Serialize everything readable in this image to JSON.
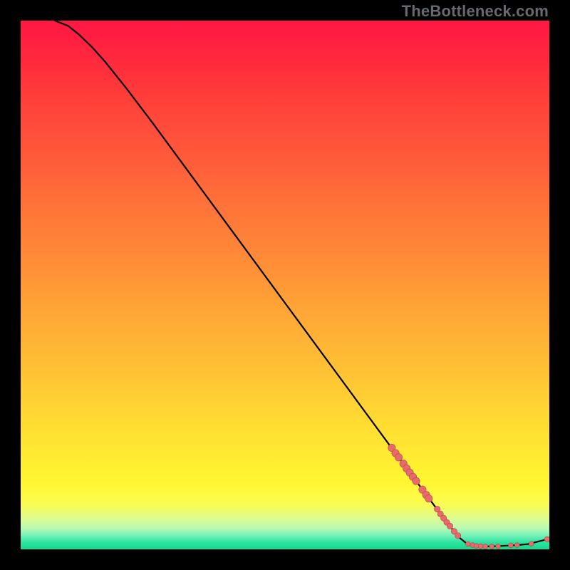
{
  "watermark": "TheBottleneck.com",
  "chart_data": {
    "type": "line",
    "title": "",
    "xlabel": "",
    "ylabel": "",
    "xlim": [
      0,
      100
    ],
    "ylim": [
      0,
      100
    ],
    "grid": false,
    "legend": false,
    "axes_visible": false,
    "gradient_background": true,
    "curve": [
      {
        "x": 6.5,
        "y": 100.0
      },
      {
        "x": 9.0,
        "y": 99.0
      },
      {
        "x": 11.0,
        "y": 97.4
      },
      {
        "x": 13.5,
        "y": 95.0
      },
      {
        "x": 16.0,
        "y": 92.2
      },
      {
        "x": 20.0,
        "y": 87.2
      },
      {
        "x": 25.0,
        "y": 80.6
      },
      {
        "x": 30.0,
        "y": 73.8
      },
      {
        "x": 35.0,
        "y": 67.0
      },
      {
        "x": 40.0,
        "y": 60.2
      },
      {
        "x": 45.0,
        "y": 53.4
      },
      {
        "x": 50.0,
        "y": 46.6
      },
      {
        "x": 55.0,
        "y": 39.8
      },
      {
        "x": 60.0,
        "y": 33.0
      },
      {
        "x": 65.0,
        "y": 26.2
      },
      {
        "x": 70.0,
        "y": 19.4
      },
      {
        "x": 74.0,
        "y": 14.0
      },
      {
        "x": 78.0,
        "y": 8.6
      },
      {
        "x": 81.0,
        "y": 4.6
      },
      {
        "x": 83.0,
        "y": 2.2
      },
      {
        "x": 84.5,
        "y": 1.0
      },
      {
        "x": 86.0,
        "y": 0.6
      },
      {
        "x": 88.0,
        "y": 0.55
      },
      {
        "x": 90.0,
        "y": 0.6
      },
      {
        "x": 92.0,
        "y": 0.7
      },
      {
        "x": 94.0,
        "y": 0.8
      },
      {
        "x": 96.0,
        "y": 1.0
      },
      {
        "x": 99.6,
        "y": 1.9
      }
    ],
    "series": [
      {
        "name": "cluster-high",
        "marker_radius": 5.2,
        "points": [
          {
            "x": 70.2,
            "y": 19.2
          },
          {
            "x": 70.9,
            "y": 18.2
          },
          {
            "x": 71.5,
            "y": 17.4
          },
          {
            "x": 72.4,
            "y": 16.2
          },
          {
            "x": 73.0,
            "y": 15.3
          },
          {
            "x": 73.6,
            "y": 14.5
          },
          {
            "x": 74.2,
            "y": 13.7
          },
          {
            "x": 74.8,
            "y": 12.9
          },
          {
            "x": 76.0,
            "y": 11.3
          },
          {
            "x": 76.7,
            "y": 10.3
          },
          {
            "x": 77.2,
            "y": 9.6
          }
        ]
      },
      {
        "name": "cluster-mid",
        "marker_radius": 4.2,
        "points": [
          {
            "x": 78.8,
            "y": 7.6
          },
          {
            "x": 79.4,
            "y": 6.7
          },
          {
            "x": 80.0,
            "y": 5.9
          },
          {
            "x": 80.6,
            "y": 5.1
          },
          {
            "x": 81.2,
            "y": 4.4
          },
          {
            "x": 82.0,
            "y": 3.4
          },
          {
            "x": 82.7,
            "y": 2.6
          }
        ]
      },
      {
        "name": "cluster-flat",
        "marker_radius": 3.4,
        "points": [
          {
            "x": 84.6,
            "y": 1.0
          },
          {
            "x": 85.5,
            "y": 0.8
          },
          {
            "x": 86.2,
            "y": 0.65
          },
          {
            "x": 87.0,
            "y": 0.6
          },
          {
            "x": 87.9,
            "y": 0.55
          },
          {
            "x": 89.1,
            "y": 0.55
          },
          {
            "x": 90.3,
            "y": 0.6
          },
          {
            "x": 92.7,
            "y": 0.75
          },
          {
            "x": 93.9,
            "y": 0.8
          },
          {
            "x": 96.6,
            "y": 1.05
          }
        ]
      },
      {
        "name": "tail-point",
        "marker_radius": 3.8,
        "points": [
          {
            "x": 99.6,
            "y": 1.9
          }
        ]
      }
    ]
  }
}
